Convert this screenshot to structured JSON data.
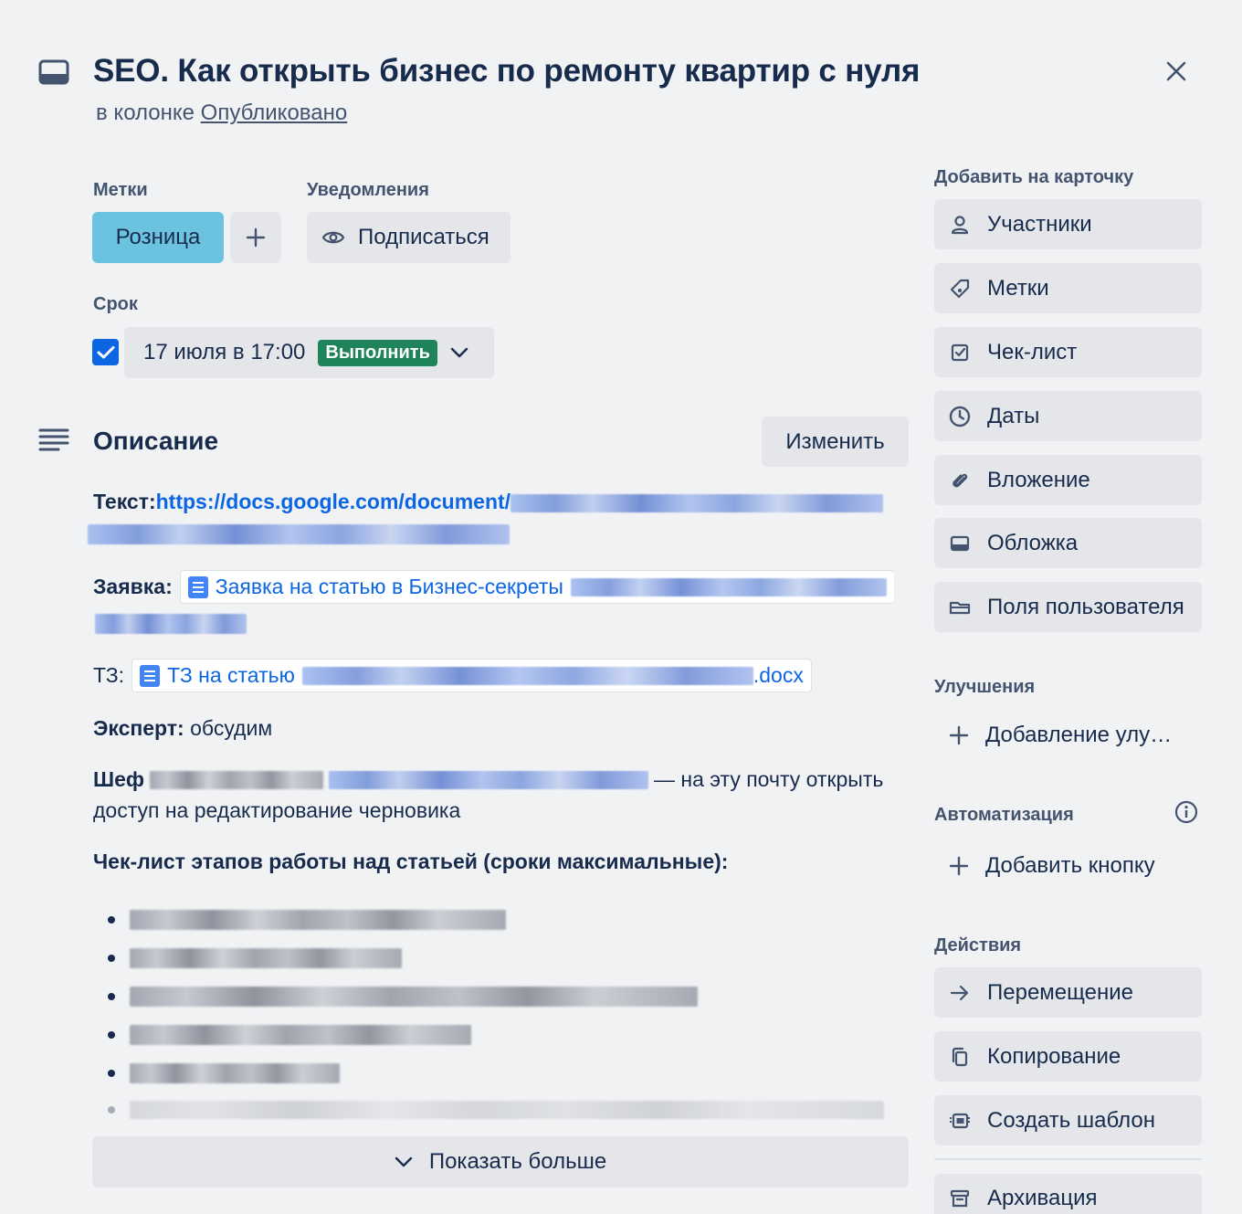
{
  "header": {
    "title": "SEO. Как открыть бизнес по ремонту квартир с нуля",
    "subtitle_prefix": "в колонке",
    "column_link": "Опубликовано"
  },
  "labels_section": {
    "heading": "Метки",
    "label_chip": "Розница",
    "label_color": "#6cc3e0"
  },
  "notifications_section": {
    "heading": "Уведомления",
    "subscribe_label": "Подписаться"
  },
  "due_section": {
    "heading": "Срок",
    "checked": true,
    "date_text": "17 июля в 17:00",
    "status_badge": "Выполнить",
    "status_color": "#1f845a"
  },
  "description": {
    "heading": "Описание",
    "edit_label": "Изменить",
    "text_label": "Текст:",
    "text_link": "https://docs.google.com/document/",
    "request_label": "Заявка:",
    "request_link": "Заявка на статью в Бизнес-секреты",
    "tz_label": "ТЗ:",
    "tz_link": "ТЗ на статью",
    "tz_suffix": ".docx",
    "expert_label": "Эксперт:",
    "expert_value": "обсудим",
    "chef_label": "Шеф",
    "chef_suffix": "— на эту почту открыть",
    "chef_line2": "доступ на редактирование черновика",
    "checklist_heading": "Чек-лист этапов работы над статьей (сроки максимальные):",
    "show_more_label": "Показать больше"
  },
  "sidebar": {
    "add_heading": "Добавить на карточку",
    "add_items": [
      {
        "label": "Участники",
        "icon": "person-icon"
      },
      {
        "label": "Метки",
        "icon": "tag-icon"
      },
      {
        "label": "Чек-лист",
        "icon": "checklist-icon"
      },
      {
        "label": "Даты",
        "icon": "clock-icon"
      },
      {
        "label": "Вложение",
        "icon": "paperclip-icon"
      },
      {
        "label": "Обложка",
        "icon": "cover-icon"
      },
      {
        "label": "Поля пользователя",
        "icon": "custom-fields-icon"
      }
    ],
    "powerups_heading": "Улучшения",
    "powerups_add": "Добавление улу…",
    "automation_heading": "Автоматизация",
    "automation_add": "Добавить кнопку",
    "actions_heading": "Действия",
    "actions": [
      {
        "label": "Перемещение",
        "icon": "arrow-right-icon"
      },
      {
        "label": "Копирование",
        "icon": "copy-icon"
      },
      {
        "label": "Создать шаблон",
        "icon": "template-icon"
      },
      {
        "label": "Архивация",
        "icon": "archive-icon"
      }
    ]
  }
}
